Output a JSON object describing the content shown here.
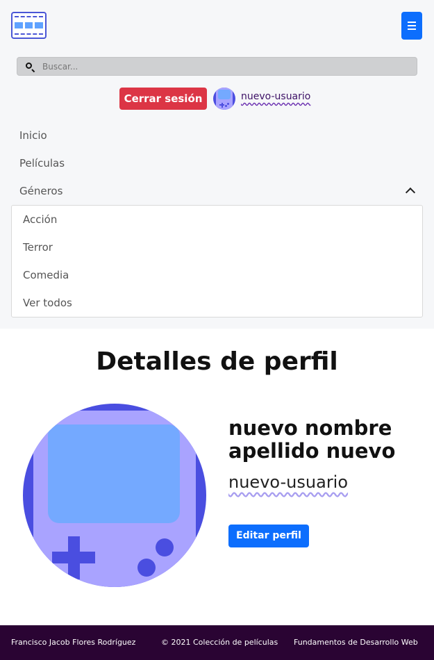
{
  "header": {
    "logo_icon": "film-strip-icon",
    "menu_icon": "hamburger-menu-icon"
  },
  "search": {
    "placeholder": "Buscar...",
    "icon": "search-icon"
  },
  "session": {
    "logout_label": "Cerrar sesión",
    "username": "nuevo-usuario",
    "avatar_icon": "gameboy-avatar-icon"
  },
  "nav": {
    "items": [
      {
        "label": "Inicio"
      },
      {
        "label": "Películas"
      },
      {
        "label": "Géneros"
      }
    ],
    "genres_dropdown": [
      {
        "label": "Acción"
      },
      {
        "label": "Terror"
      },
      {
        "label": "Comedia"
      },
      {
        "label": "Ver todos"
      }
    ]
  },
  "profile": {
    "title": "Detalles de perfil",
    "full_name": "nuevo nombre apellido nuevo",
    "username": "nuevo-usuario",
    "edit_label": "Editar perfil",
    "avatar_icon": "gameboy-avatar-icon"
  },
  "footer": {
    "author": "Francisco Jacob Flores Rodríguez",
    "copyright": "© 2021 Colección de películas",
    "course": "Fundamentos de Desarrollo Web"
  },
  "colors": {
    "primary": "#0d6efd",
    "danger": "#dc3545",
    "footer_bg": "#2a0433",
    "avatar_dark": "#4a4ee0",
    "avatar_light": "#a9a3ff",
    "avatar_screen": "#74a9ff"
  }
}
